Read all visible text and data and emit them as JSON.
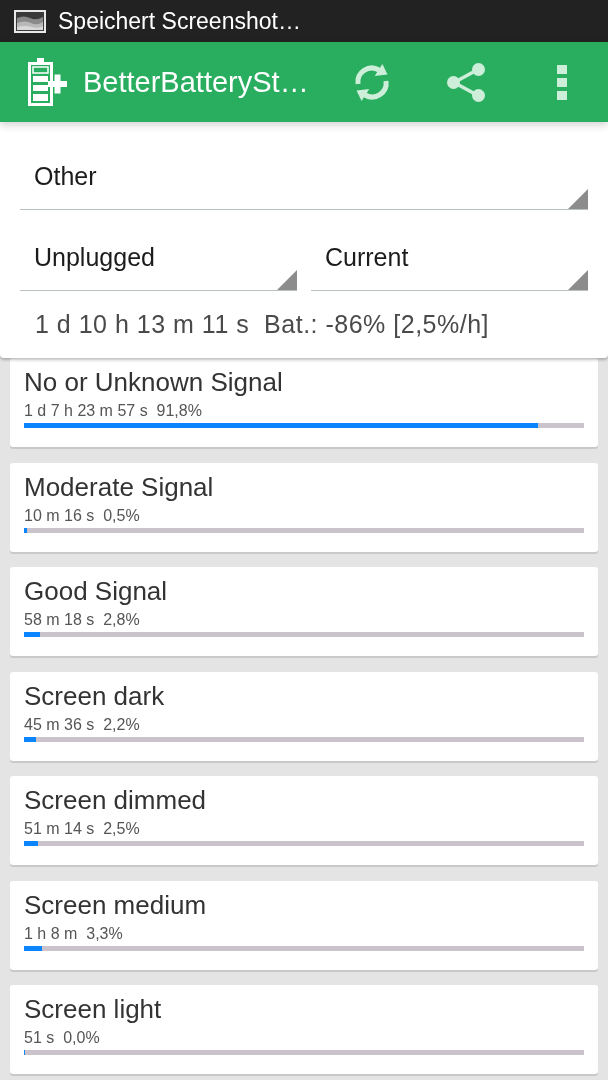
{
  "status_bar": {
    "notification": "Speichert Screenshot…"
  },
  "action_bar": {
    "title": "BetterBatterySt…"
  },
  "filters": {
    "rows": [
      [
        {
          "value": "Other"
        }
      ],
      [
        {
          "value": "Unplugged"
        },
        {
          "value": "Current"
        }
      ]
    ],
    "summary": "1 d 10 h 13 m 11 s  Bat.: -86% [2,5%/h]"
  },
  "stats": [
    {
      "title": "No or Unknown Signal",
      "detail": "1 d 7 h 23 m 57 s  91,8%",
      "level": 0.918
    },
    {
      "title": "Moderate Signal",
      "detail": "10 m 16 s  0,5%",
      "level": 0.005
    },
    {
      "title": "Good Signal",
      "detail": "58 m 18 s  2,8%",
      "level": 0.028
    },
    {
      "title": "Screen dark",
      "detail": "45 m 36 s  2,2%",
      "level": 0.022
    },
    {
      "title": "Screen dimmed",
      "detail": "51 m 14 s  2,5%",
      "level": 0.025
    },
    {
      "title": "Screen medium",
      "detail": "1 h 8 m  3,3%",
      "level": 0.033
    },
    {
      "title": "Screen light",
      "detail": "51 s  0,0%",
      "level": 0.0
    }
  ]
}
